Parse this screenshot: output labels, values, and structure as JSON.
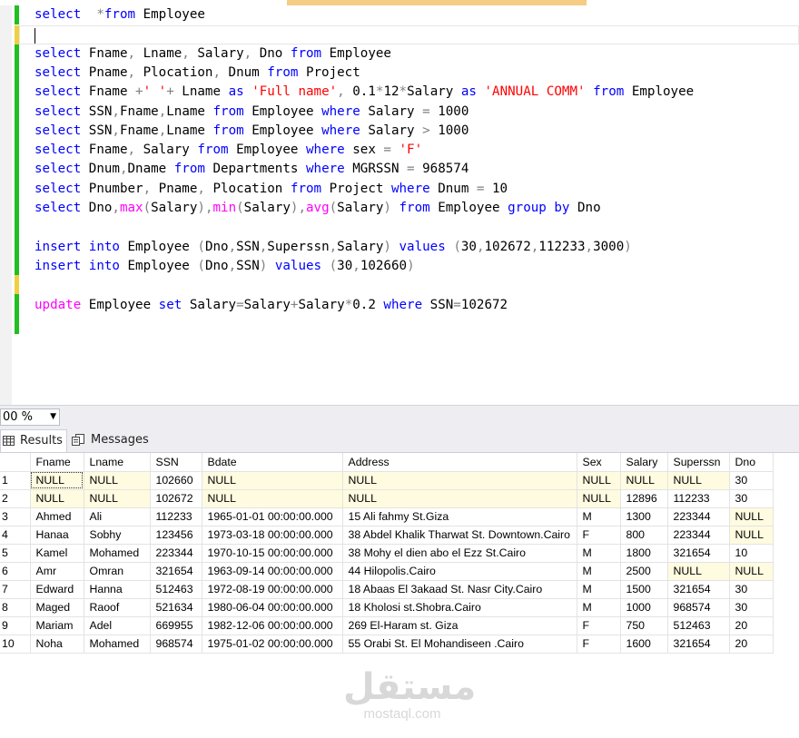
{
  "zoom": "00 %",
  "tabs": {
    "results": "Results",
    "messages": "Messages"
  },
  "editor": {
    "lines": [
      [
        [
          "kw",
          "select"
        ],
        [
          "",
          "  "
        ],
        [
          "op",
          "*"
        ],
        [
          "",
          ""
        ],
        [
          "kw",
          "from"
        ],
        [
          "",
          " Employee"
        ]
      ],
      [],
      [
        [
          "kw",
          "select"
        ],
        [
          "",
          " Fname"
        ],
        [
          "op",
          ","
        ],
        [
          "",
          " Lname"
        ],
        [
          "op",
          ","
        ],
        [
          "",
          " Salary"
        ],
        [
          "op",
          ","
        ],
        [
          "",
          " Dno "
        ],
        [
          "kw",
          "from"
        ],
        [
          "",
          " Employee"
        ]
      ],
      [
        [
          "kw",
          "select"
        ],
        [
          "",
          " Pname"
        ],
        [
          "op",
          ","
        ],
        [
          "",
          " Plocation"
        ],
        [
          "op",
          ","
        ],
        [
          "",
          " Dnum "
        ],
        [
          "kw",
          "from"
        ],
        [
          "",
          " Project"
        ]
      ],
      [
        [
          "kw",
          "select"
        ],
        [
          "",
          " Fname "
        ],
        [
          "op",
          "+"
        ],
        [
          "str",
          "' '"
        ],
        [
          "op",
          "+"
        ],
        [
          "",
          " Lname "
        ],
        [
          "kw",
          "as"
        ],
        [
          "",
          " "
        ],
        [
          "str",
          "'Full name'"
        ],
        [
          "op",
          ","
        ],
        [
          "",
          " 0.1"
        ],
        [
          "op",
          "*"
        ],
        [
          "",
          "12"
        ],
        [
          "op",
          "*"
        ],
        [
          "",
          "Salary "
        ],
        [
          "kw",
          "as"
        ],
        [
          "",
          " "
        ],
        [
          "str",
          "'ANNUAL COMM'"
        ],
        [
          "",
          " "
        ],
        [
          "kw",
          "from"
        ],
        [
          "",
          " Employee"
        ]
      ],
      [
        [
          "kw",
          "select"
        ],
        [
          "",
          " SSN"
        ],
        [
          "op",
          ","
        ],
        [
          "",
          "Fname"
        ],
        [
          "op",
          ","
        ],
        [
          "",
          "Lname "
        ],
        [
          "kw",
          "from"
        ],
        [
          "",
          " Employee "
        ],
        [
          "kw",
          "where"
        ],
        [
          "",
          " Salary "
        ],
        [
          "op",
          "="
        ],
        [
          "",
          " 1000"
        ]
      ],
      [
        [
          "kw",
          "select"
        ],
        [
          "",
          " SSN"
        ],
        [
          "op",
          ","
        ],
        [
          "",
          "Fname"
        ],
        [
          "op",
          ","
        ],
        [
          "",
          "Lname "
        ],
        [
          "kw",
          "from"
        ],
        [
          "",
          " Employee "
        ],
        [
          "kw",
          "where"
        ],
        [
          "",
          " Salary "
        ],
        [
          "op",
          ">"
        ],
        [
          "",
          " 1000"
        ]
      ],
      [
        [
          "kw",
          "select"
        ],
        [
          "",
          " Fname"
        ],
        [
          "op",
          ","
        ],
        [
          "",
          " Salary "
        ],
        [
          "kw",
          "from"
        ],
        [
          "",
          " Employee "
        ],
        [
          "kw",
          "where"
        ],
        [
          "",
          " sex "
        ],
        [
          "op",
          "="
        ],
        [
          "",
          " "
        ],
        [
          "str",
          "'F'"
        ]
      ],
      [
        [
          "kw",
          "select"
        ],
        [
          "",
          " Dnum"
        ],
        [
          "op",
          ","
        ],
        [
          "",
          "Dname "
        ],
        [
          "kw",
          "from"
        ],
        [
          "",
          " Departments "
        ],
        [
          "kw",
          "where"
        ],
        [
          "",
          " MGRSSN "
        ],
        [
          "op",
          "="
        ],
        [
          "",
          " 968574"
        ]
      ],
      [
        [
          "kw",
          "select"
        ],
        [
          "",
          " Pnumber"
        ],
        [
          "op",
          ","
        ],
        [
          "",
          " Pname"
        ],
        [
          "op",
          ","
        ],
        [
          "",
          " Plocation "
        ],
        [
          "kw",
          "from"
        ],
        [
          "",
          " Project "
        ],
        [
          "kw",
          "where"
        ],
        [
          "",
          " Dnum "
        ],
        [
          "op",
          "="
        ],
        [
          "",
          " 10"
        ]
      ],
      [
        [
          "kw",
          "select"
        ],
        [
          "",
          " Dno"
        ],
        [
          "op",
          ","
        ],
        [
          "fn",
          "max"
        ],
        [
          "op",
          "("
        ],
        [
          "",
          "Salary"
        ],
        [
          "op",
          ")"
        ],
        [
          "op",
          ","
        ],
        [
          "fn",
          "min"
        ],
        [
          "op",
          "("
        ],
        [
          "",
          "Salary"
        ],
        [
          "op",
          ")"
        ],
        [
          "op",
          ","
        ],
        [
          "fn",
          "avg"
        ],
        [
          "op",
          "("
        ],
        [
          "",
          "Salary"
        ],
        [
          "op",
          ")"
        ],
        [
          "",
          " "
        ],
        [
          "kw",
          "from"
        ],
        [
          "",
          " Employee "
        ],
        [
          "kw",
          "group by"
        ],
        [
          "",
          " Dno"
        ]
      ],
      [],
      [
        [
          "kw",
          "insert into"
        ],
        [
          "",
          " Employee "
        ],
        [
          "op",
          "("
        ],
        [
          "",
          "Dno"
        ],
        [
          "op",
          ","
        ],
        [
          "",
          "SSN"
        ],
        [
          "op",
          ","
        ],
        [
          "",
          "Superssn"
        ],
        [
          "op",
          ","
        ],
        [
          "",
          "Salary"
        ],
        [
          "op",
          ")"
        ],
        [
          "",
          " "
        ],
        [
          "kw",
          "values"
        ],
        [
          "",
          " "
        ],
        [
          "op",
          "("
        ],
        [
          "",
          "30"
        ],
        [
          "op",
          ","
        ],
        [
          "",
          "102672"
        ],
        [
          "op",
          ","
        ],
        [
          "",
          "112233"
        ],
        [
          "op",
          ","
        ],
        [
          "",
          "3000"
        ],
        [
          "op",
          ")"
        ]
      ],
      [
        [
          "kw",
          "insert into"
        ],
        [
          "",
          " Employee "
        ],
        [
          "op",
          "("
        ],
        [
          "",
          "Dno"
        ],
        [
          "op",
          ","
        ],
        [
          "",
          "SSN"
        ],
        [
          "op",
          ")"
        ],
        [
          "",
          " "
        ],
        [
          "kw",
          "values"
        ],
        [
          "",
          " "
        ],
        [
          "op",
          "("
        ],
        [
          "",
          "30"
        ],
        [
          "op",
          ","
        ],
        [
          "",
          "102660"
        ],
        [
          "op",
          ")"
        ]
      ],
      [],
      [
        [
          "fn",
          "update"
        ],
        [
          "",
          " Employee "
        ],
        [
          "kw",
          "set"
        ],
        [
          "",
          " Salary"
        ],
        [
          "op",
          "="
        ],
        [
          "",
          "Salary"
        ],
        [
          "op",
          "+"
        ],
        [
          "",
          "Salary"
        ],
        [
          "op",
          "*"
        ],
        [
          "",
          "0.2 "
        ],
        [
          "kw",
          "where"
        ],
        [
          "",
          " SSN"
        ],
        [
          "op",
          "="
        ],
        [
          "",
          "102672"
        ]
      ]
    ]
  },
  "grid": {
    "columns": [
      "Fname",
      "Lname",
      "SSN",
      "Bdate",
      "Address",
      "Sex",
      "Salary",
      "Superssn",
      "Dno"
    ],
    "rows": [
      [
        "1",
        "NULL",
        "NULL",
        "102660",
        "NULL",
        "NULL",
        "NULL",
        "NULL",
        "NULL",
        "30"
      ],
      [
        "2",
        "NULL",
        "NULL",
        "102672",
        "NULL",
        "NULL",
        "NULL",
        "12896",
        "112233",
        "30"
      ],
      [
        "3",
        "Ahmed",
        "Ali",
        "112233",
        "1965-01-01 00:00:00.000",
        "15 Ali fahmy St.Giza",
        "M",
        "1300",
        "223344",
        "NULL"
      ],
      [
        "4",
        "Hanaa",
        "Sobhy",
        "123456",
        "1973-03-18 00:00:00.000",
        "38 Abdel Khalik Tharwat St. Downtown.Cairo",
        "F",
        "800",
        "223344",
        "NULL"
      ],
      [
        "5",
        "Kamel",
        "Mohamed",
        "223344",
        "1970-10-15 00:00:00.000",
        "38 Mohy el dien abo el Ezz  St.Cairo",
        "M",
        "1800",
        "321654",
        "10"
      ],
      [
        "6",
        "Amr",
        "Omran",
        "321654",
        "1963-09-14 00:00:00.000",
        "44 Hilopolis.Cairo",
        "M",
        "2500",
        "NULL",
        "NULL"
      ],
      [
        "7",
        "Edward",
        "Hanna",
        "512463",
        "1972-08-19 00:00:00.000",
        "18 Abaas El 3akaad St. Nasr City.Cairo",
        "M",
        "1500",
        "321654",
        "30"
      ],
      [
        "8",
        "Maged",
        "Raoof",
        "521634",
        "1980-06-04 00:00:00.000",
        "18 Kholosi st.Shobra.Cairo",
        "M",
        "1000",
        "968574",
        "30"
      ],
      [
        "9",
        "Mariam",
        "Adel",
        "669955",
        "1982-12-06 00:00:00.000",
        "269 El-Haram st. Giza",
        "F",
        "750",
        "512463",
        "20"
      ],
      [
        "10",
        "Noha",
        "Mohamed",
        "968574",
        "1975-01-02 00:00:00.000",
        "55 Orabi St. El Mohandiseen .Cairo",
        "F",
        "1600",
        "321654",
        "20"
      ]
    ]
  },
  "watermark": {
    "arabic": "مستقل",
    "latin": "mostaql.com"
  }
}
